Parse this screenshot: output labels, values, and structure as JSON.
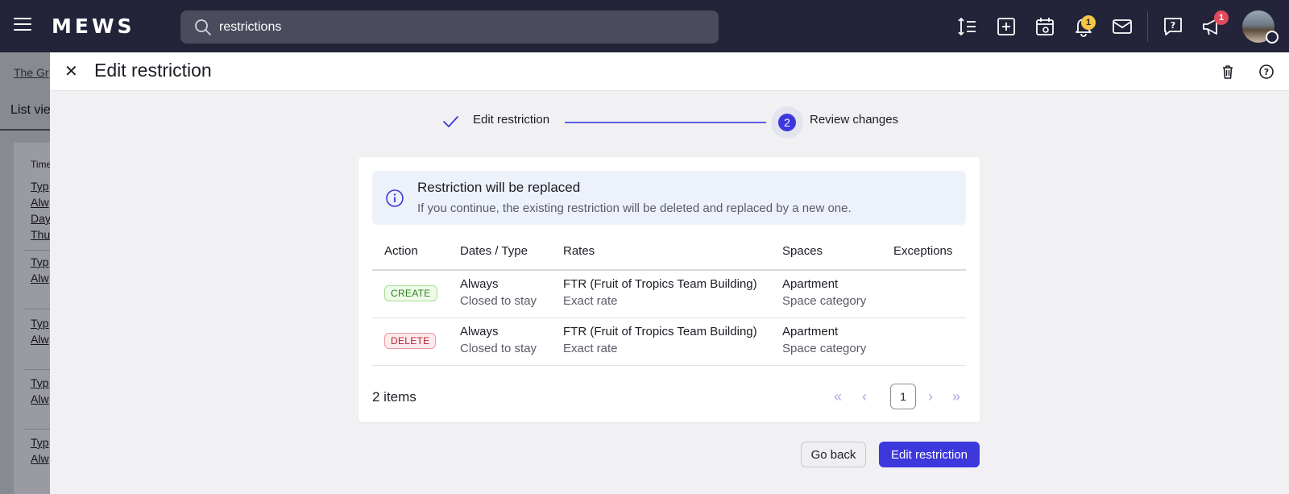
{
  "topbar": {
    "logo": "MEWS",
    "search": {
      "value": "restrictions",
      "placeholder": ""
    },
    "notifications_badge": "1",
    "announcements_badge": "1",
    "brand_color": "#23243a"
  },
  "background_page": {
    "breadcrumb": "The Gr",
    "list_view": "List vie",
    "table_header": "Time",
    "cells": [
      "Typ",
      "Alw",
      "Day",
      "Thu",
      "Typ",
      "Alw",
      "Typ",
      "Alw",
      "Typ",
      "Alw",
      "Typ",
      "Alw"
    ]
  },
  "drawer": {
    "title": "Edit restriction",
    "stepper": {
      "step1": {
        "label": "Edit restriction",
        "status": "done"
      },
      "step2": {
        "number": "2",
        "label": "Review changes",
        "status": "active"
      }
    },
    "alert": {
      "title": "Restriction will be replaced",
      "text": "If you continue, the existing restriction will be deleted and replaced by a new one."
    },
    "table": {
      "columns": [
        "Action",
        "Dates / Type",
        "Rates",
        "Spaces",
        "Exceptions"
      ],
      "rows": [
        {
          "action": "CREATE",
          "date": "Always",
          "type": "Closed to stay",
          "rate": "FTR (Fruit of Tropics Team Building)",
          "rate_type": "Exact rate",
          "space": "Apartment",
          "space_type": "Space category",
          "exceptions": ""
        },
        {
          "action": "DELETE",
          "date": "Always",
          "type": "Closed to stay",
          "rate": "FTR (Fruit of Tropics Team Building)",
          "rate_type": "Exact rate",
          "space": "Apartment",
          "space_type": "Space category",
          "exceptions": ""
        }
      ]
    },
    "pagination": {
      "items_label": "2 items",
      "current_page": "1",
      "first": "«",
      "prev": "‹",
      "next": "›",
      "last": "»"
    },
    "buttons": {
      "back": "Go back",
      "primary": "Edit restriction"
    },
    "accent_color": "#3d38dc"
  }
}
